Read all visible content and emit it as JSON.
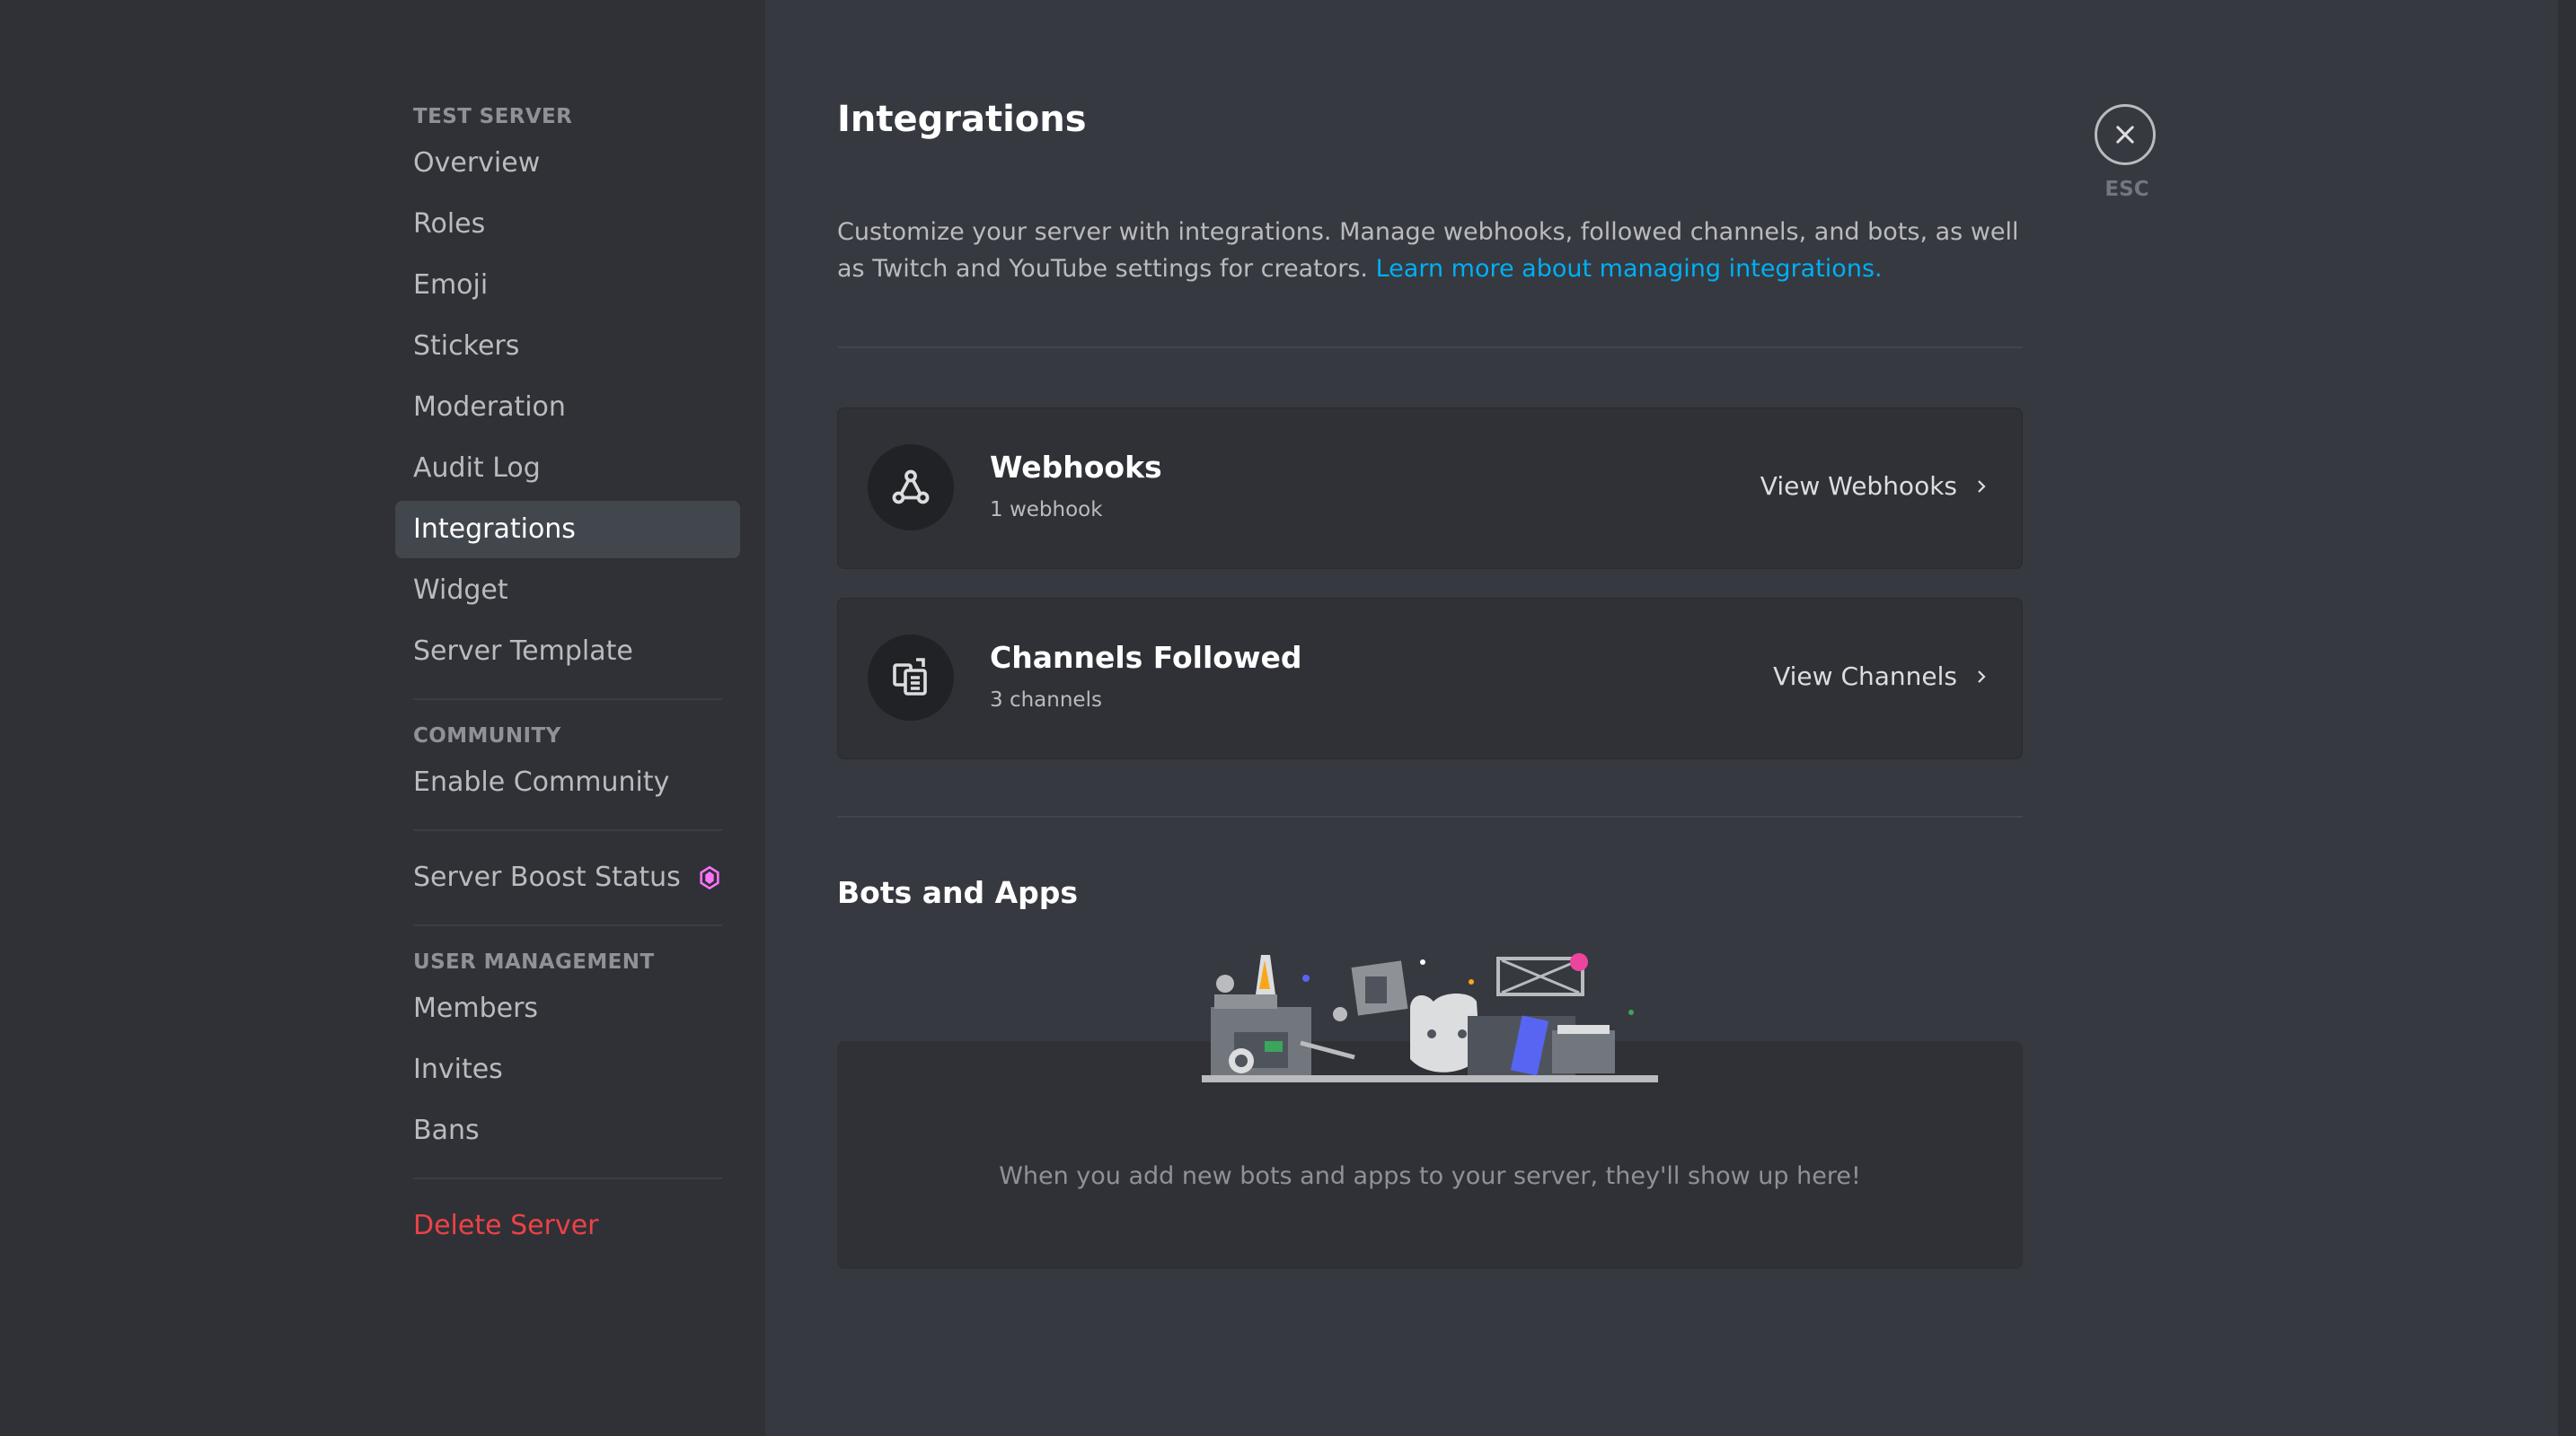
{
  "sidebar": {
    "server_header": "TEST SERVER",
    "server_items": [
      {
        "label": "Overview"
      },
      {
        "label": "Roles"
      },
      {
        "label": "Emoji"
      },
      {
        "label": "Stickers"
      },
      {
        "label": "Moderation"
      },
      {
        "label": "Audit Log"
      },
      {
        "label": "Integrations",
        "active": true
      },
      {
        "label": "Widget"
      },
      {
        "label": "Server Template"
      }
    ],
    "community_header": "COMMUNITY",
    "community_items": [
      {
        "label": "Enable Community"
      }
    ],
    "boost_item": {
      "label": "Server Boost Status",
      "icon": "boost-gem-icon",
      "color": "#ff73fa"
    },
    "user_mgmt_header": "USER MANAGEMENT",
    "user_mgmt_items": [
      {
        "label": "Members"
      },
      {
        "label": "Invites"
      },
      {
        "label": "Bans"
      }
    ],
    "delete_item": {
      "label": "Delete Server",
      "color": "#ed4245"
    }
  },
  "main": {
    "title": "Integrations",
    "description": "Customize your server with integrations. Manage webhooks, followed channels, and bots, as well as Twitch and YouTube settings for creators. ",
    "learn_more_link": "Learn more about managing integrations.",
    "cards": [
      {
        "title": "Webhooks",
        "subtitle": "1 webhook",
        "action": "View Webhooks",
        "icon": "webhook-icon"
      },
      {
        "title": "Channels Followed",
        "subtitle": "3 channels",
        "action": "View Channels",
        "icon": "channel-follow-icon"
      }
    ],
    "bots_title": "Bots and Apps",
    "bots_empty_text": "When you add new bots and apps to your server, they'll show up here!"
  },
  "close": {
    "label": "ESC",
    "icon": "close-icon"
  },
  "colors": {
    "accent_link": "#00aff4",
    "danger": "#ed4245",
    "boost": "#ff73fa",
    "background": "#36393f",
    "sidebar": "#2f3136"
  }
}
